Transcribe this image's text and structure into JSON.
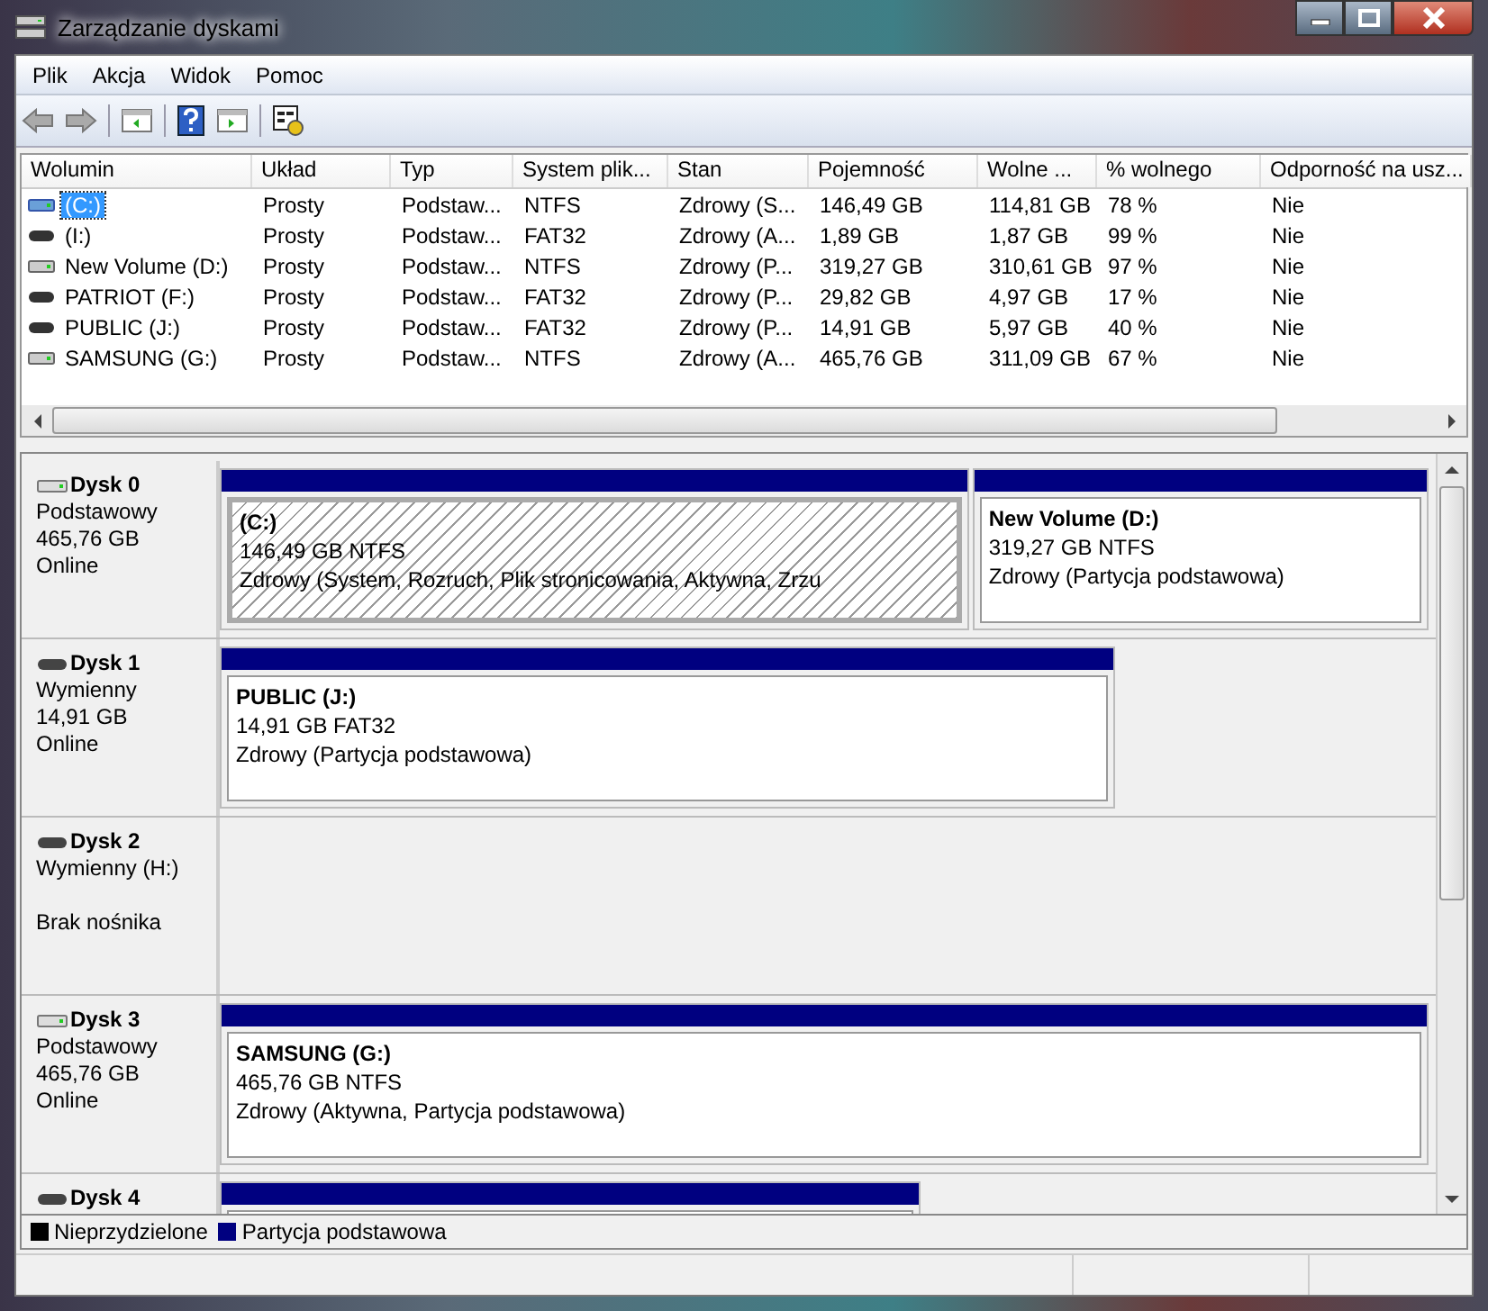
{
  "window": {
    "title": "Zarządzanie dyskami"
  },
  "menu": [
    "Plik",
    "Akcja",
    "Widok",
    "Pomoc"
  ],
  "table": {
    "columns": [
      "Wolumin",
      "Układ",
      "Typ",
      "System plik...",
      "Stan",
      "Pojemność",
      "Wolne ...",
      "% wolnego",
      "Odporność na usz..."
    ],
    "rows": [
      {
        "kind": "system",
        "selected": true,
        "cells": [
          "(C:)",
          "Prosty",
          "Podstaw...",
          "NTFS",
          "Zdrowy (S...",
          "146,49 GB",
          "114,81 GB",
          "78 %",
          "Nie"
        ]
      },
      {
        "kind": "removable",
        "selected": false,
        "cells": [
          "(I:)",
          "Prosty",
          "Podstaw...",
          "FAT32",
          "Zdrowy (A...",
          "1,89 GB",
          "1,87 GB",
          "99 %",
          "Nie"
        ]
      },
      {
        "kind": "hdd",
        "selected": false,
        "cells": [
          "New Volume (D:)",
          "Prosty",
          "Podstaw...",
          "NTFS",
          "Zdrowy (P...",
          "319,27 GB",
          "310,61 GB",
          "97 %",
          "Nie"
        ]
      },
      {
        "kind": "removable",
        "selected": false,
        "cells": [
          "PATRIOT (F:)",
          "Prosty",
          "Podstaw...",
          "FAT32",
          "Zdrowy (P...",
          "29,82 GB",
          "4,97 GB",
          "17 %",
          "Nie"
        ]
      },
      {
        "kind": "removable",
        "selected": false,
        "cells": [
          "PUBLIC (J:)",
          "Prosty",
          "Podstaw...",
          "FAT32",
          "Zdrowy (P...",
          "14,91 GB",
          "5,97 GB",
          "40 %",
          "Nie"
        ]
      },
      {
        "kind": "hdd",
        "selected": false,
        "cells": [
          "SAMSUNG (G:)",
          "Prosty",
          "Podstaw...",
          "NTFS",
          "Zdrowy (A...",
          "465,76 GB",
          "311,09 GB",
          "67 %",
          "Nie"
        ]
      }
    ]
  },
  "disks": [
    {
      "kind": "hdd",
      "name": "Dysk 0",
      "lines": [
        "Podstawowy",
        "465,76 GB",
        "Online"
      ],
      "partitions": [
        {
          "selected": true,
          "title": "(C:)",
          "lines": [
            "146,49 GB NTFS",
            "Zdrowy (System, Rozruch, Plik stronicowania, Aktywna, Zrzu"
          ]
        },
        {
          "selected": false,
          "title": "New Volume  (D:)",
          "lines": [
            "319,27 GB NTFS",
            "Zdrowy (Partycja podstawowa)"
          ]
        }
      ]
    },
    {
      "kind": "removable",
      "name": "Dysk 1",
      "lines": [
        "Wymienny",
        "14,91 GB",
        "Online"
      ],
      "partitions": [
        {
          "selected": false,
          "title": "PUBLIC  (J:)",
          "lines": [
            "14,91 GB FAT32",
            "Zdrowy (Partycja podstawowa)"
          ]
        }
      ]
    },
    {
      "kind": "removable",
      "name": "Dysk 2",
      "lines": [
        "Wymienny (H:)"
      ],
      "note": "Brak nośnika"
    },
    {
      "kind": "hdd",
      "name": "Dysk 3",
      "lines": [
        "Podstawowy",
        "465,76 GB",
        "Online"
      ],
      "partitions": [
        {
          "selected": false,
          "title": "SAMSUNG  (G:)",
          "lines": [
            "465,76 GB NTFS",
            "Zdrowy (Aktywna, Partycja podstawowa)"
          ]
        }
      ]
    },
    {
      "kind": "removable",
      "name": "Dysk 4",
      "partitions": [
        {
          "selected": false
        }
      ]
    }
  ],
  "legend": [
    {
      "label": "Nieprzydzielone",
      "color": "#000000"
    },
    {
      "label": "Partycja podstawowa",
      "color": "#000080"
    }
  ]
}
